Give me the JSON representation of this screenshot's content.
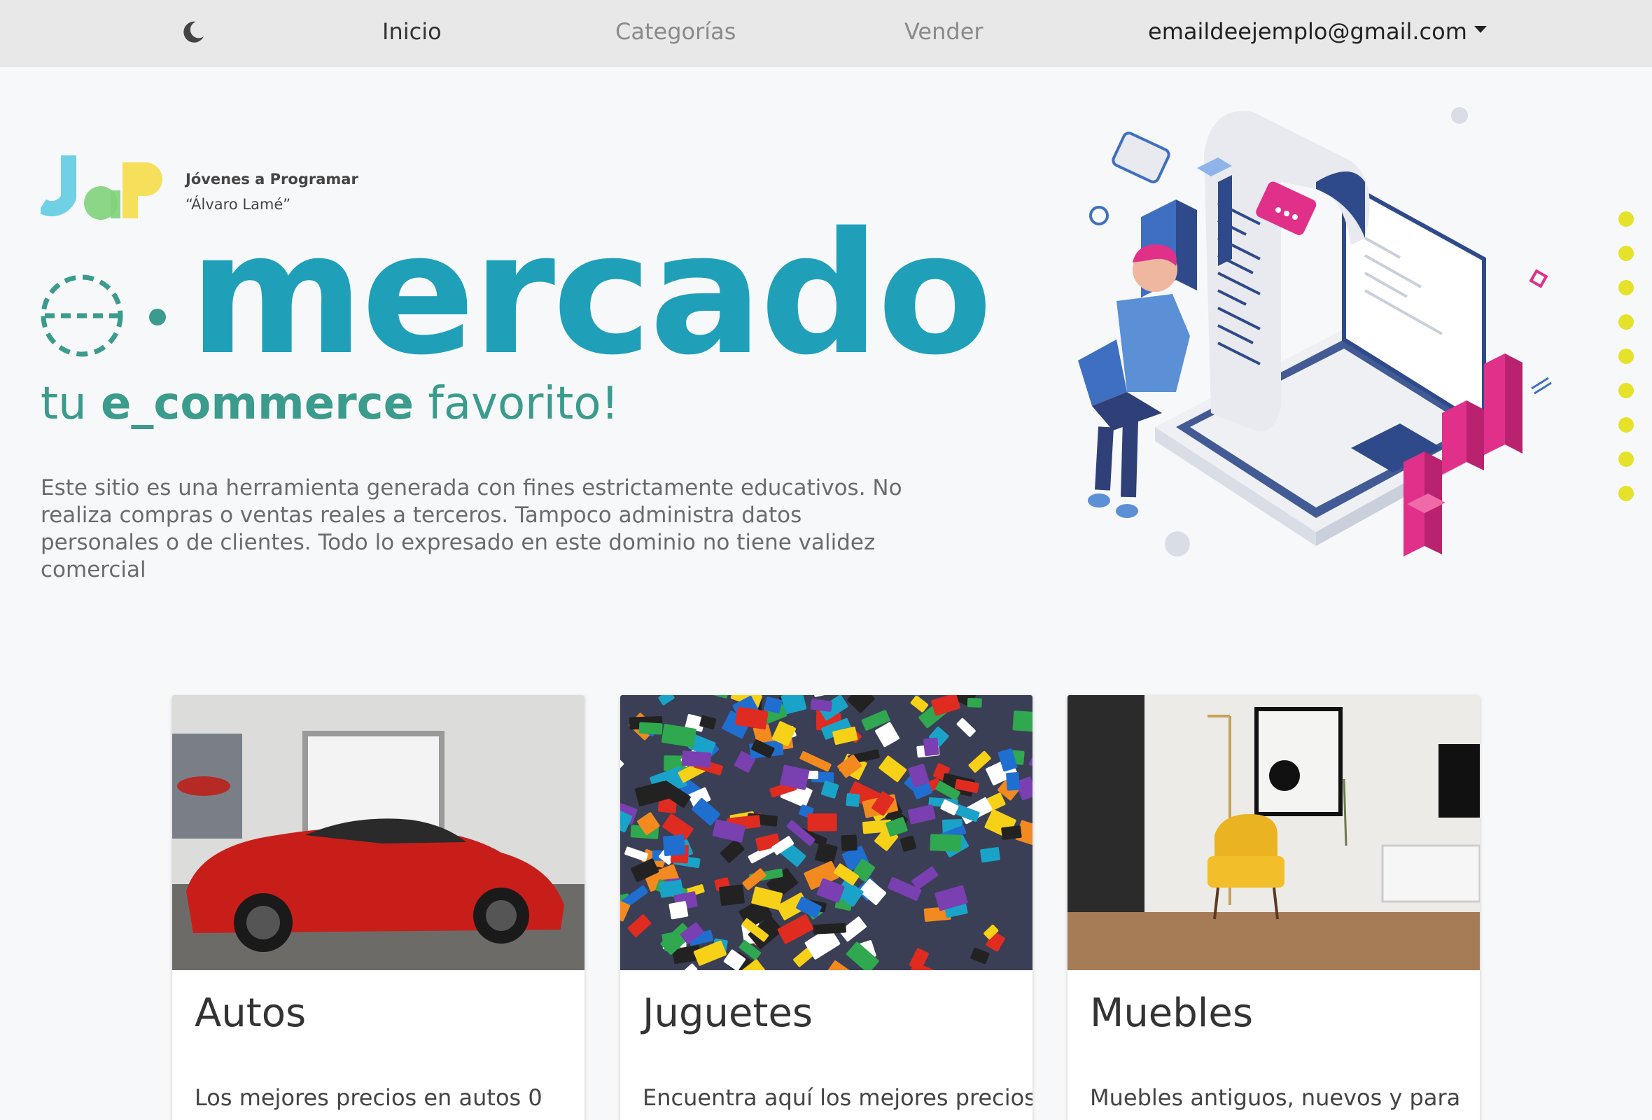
{
  "navbar": {
    "theme_toggle_icon": "moon-icon",
    "links": [
      {
        "label": "Inicio",
        "active": true
      },
      {
        "label": "Categorías",
        "active": false
      },
      {
        "label": "Vender",
        "active": false
      }
    ],
    "user_email": "emaildeejemplo@gmail.com"
  },
  "hero": {
    "logo_org_line1": "Jóvenes a Programar",
    "logo_org_line2": "“Álvaro Lamé”",
    "brand_name": "mercado",
    "tagline_prefix": "tu ",
    "tagline_bold": "e_commerce",
    "tagline_suffix": " favorito!",
    "disclaimer": "Este sitio  es una herramienta generada con fines estrictamente educativos. No realiza compras o ventas reales a terceros. Tampoco administra datos personales o de clientes. Todo lo expresado en este dominio no tiene validez comercial"
  },
  "categories": [
    {
      "title": "Autos",
      "description": "Los mejores precios en autos 0",
      "image": "red-sports-car"
    },
    {
      "title": "Juguetes",
      "description": "Encuentra aquí los mejores precios",
      "image": "colorful-toy-bricks"
    },
    {
      "title": "Muebles",
      "description": "Muebles antiguos, nuevos y para",
      "image": "yellow-armchair-room"
    }
  ],
  "colors": {
    "navbar_bg": "#e8e8e8",
    "page_bg": "#f7f8fa",
    "brand_teal": "#1fa0b8",
    "tagline_green": "#3b9b8c",
    "accent_pink": "#e0308a",
    "accent_navy": "#2f4a8a",
    "dot_yellow": "#e6e22a"
  }
}
